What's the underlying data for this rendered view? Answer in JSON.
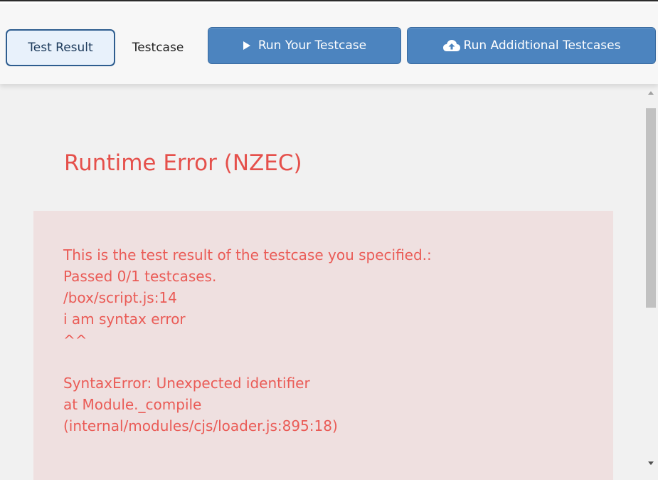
{
  "toolbar": {
    "tabs": [
      {
        "label": "Test Result",
        "active": true
      },
      {
        "label": "Testcase",
        "active": false
      }
    ],
    "run_button": {
      "label": "Run Your Testcase",
      "icon": "play-icon"
    },
    "run_more_button": {
      "label": "Run Addidtional Testcases",
      "icon": "cloud-upload-icon"
    }
  },
  "result": {
    "heading": "Runtime Error (NZEC)",
    "lines": [
      "This is the test result of the testcase you specified.:",
      "Passed 0/1 testcases.",
      "/box/script.js:14",
      "i am syntax error",
      "^^",
      "",
      "SyntaxError: Unexpected identifier",
      "at Module._compile",
      "(internal/modules/cjs/loader.js:895:18)"
    ]
  },
  "colors": {
    "accent": "#4c84bf",
    "error_text": "#e5504b",
    "error_bg": "#efe0e0"
  }
}
